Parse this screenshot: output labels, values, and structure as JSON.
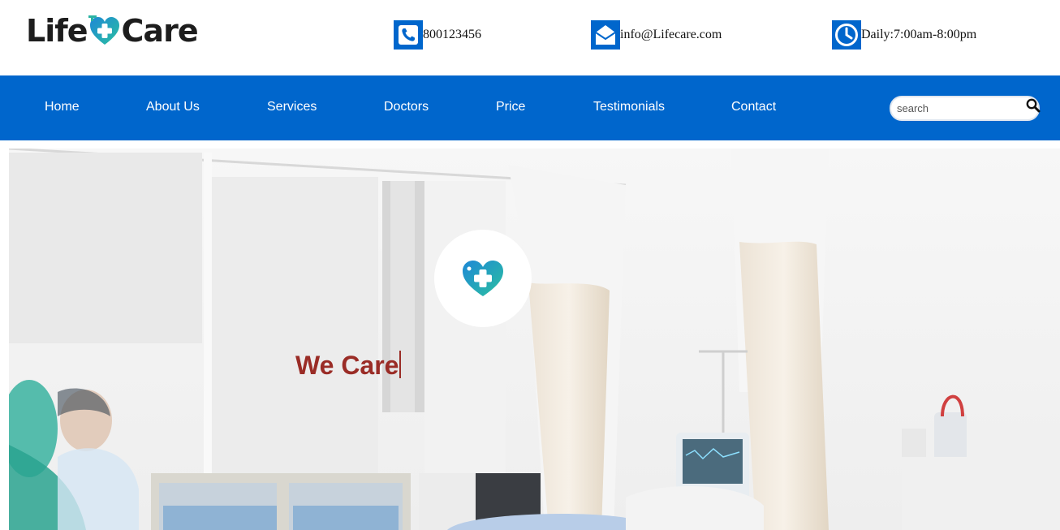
{
  "brand": {
    "name_left": "Life",
    "name_right": "Care",
    "logo_icon": "heart-plus-icon",
    "accent_color": "#0066cc",
    "logo_teal": "#2bb3a3"
  },
  "contacts": {
    "phone": {
      "icon": "phone-icon",
      "text": "800123456"
    },
    "email": {
      "icon": "mail-icon",
      "text": "info@Lifecare.com"
    },
    "hours": {
      "icon": "clock-icon",
      "text": "Daily:7:00am-8:00pm"
    }
  },
  "nav": {
    "items": [
      {
        "label": "Home"
      },
      {
        "label": "About Us"
      },
      {
        "label": "Services"
      },
      {
        "label": "Doctors"
      },
      {
        "label": "Price"
      },
      {
        "label": "Testimonials"
      },
      {
        "label": "Contact"
      }
    ],
    "search": {
      "placeholder": "search",
      "value": "",
      "icon": "search-icon"
    }
  },
  "hero": {
    "title": "We Care",
    "title_color": "#9a2c26",
    "badge_icon": "heart-plus-icon",
    "background": "hospital-room-photo"
  }
}
